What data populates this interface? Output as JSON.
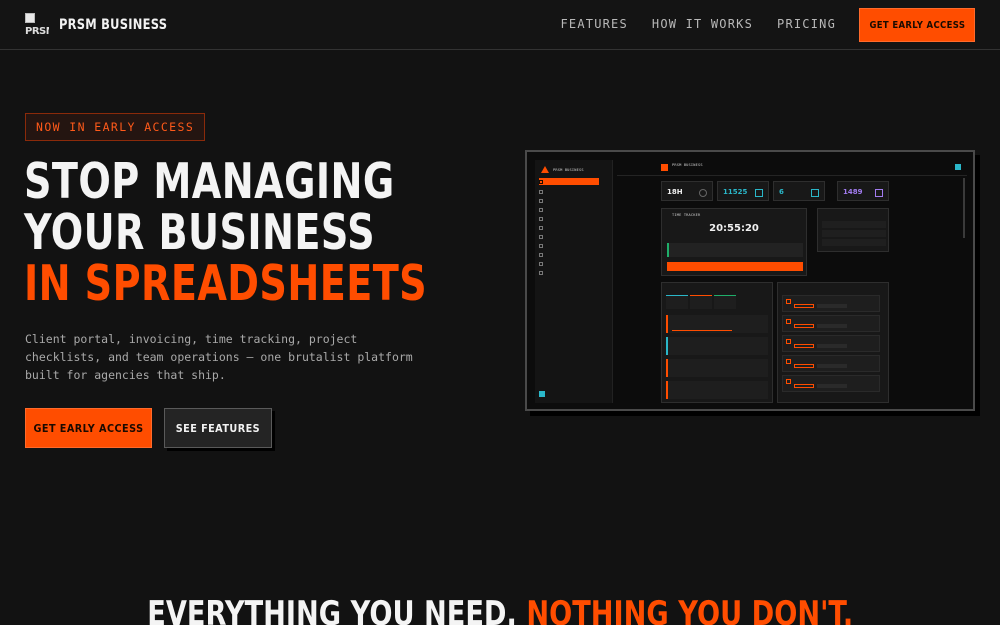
{
  "nav": {
    "brand_logo_alt": "PRSM",
    "brand_name": "PRSM BUSINESS",
    "links": [
      "FEATURES",
      "HOW IT WORKS",
      "PRICING"
    ],
    "cta_label": "GET EARLY ACCESS"
  },
  "hero": {
    "badge": "NOW IN EARLY ACCESS",
    "headline_line1": "STOP MANAGING",
    "headline_line2": "YOUR BUSINESS",
    "headline_line3": "IN SPREADSHEETS",
    "subtext": "Client portal, invoicing, time tracking, project checklists, and team operations — one brutalist platform built for agencies that ship.",
    "primary_button": "GET EARLY ACCESS",
    "secondary_button": "SEE FEATURES"
  },
  "mockup": {
    "sidebar_brand": "PRSM BUSINESS",
    "header_title": "PRSM BUSINESS",
    "stats": [
      {
        "value": "18H",
        "color": "#eeeeee"
      },
      {
        "value": "11525",
        "color": "#2ab7c9"
      },
      {
        "value": "6",
        "color": "#2ab7c9"
      },
      {
        "value": "1489",
        "color": "#a27cf0"
      }
    ],
    "time_tracker": {
      "title": "TIME TRACKER",
      "clock": "20:55:20"
    }
  },
  "section": {
    "title_part1": "EVERYTHING YOU NEED.",
    "title_part2": "NOTHING YOU DON'T."
  },
  "colors": {
    "accent": "#ff4d00",
    "background": "#121212",
    "cyan": "#2ab7c9"
  }
}
